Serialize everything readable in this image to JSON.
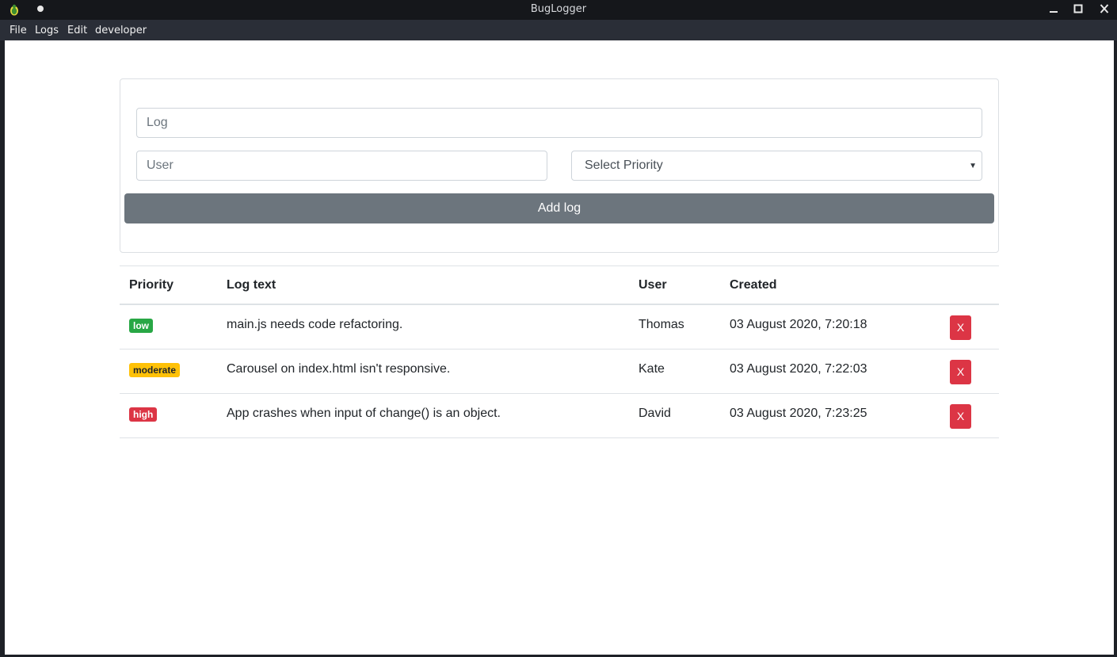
{
  "window": {
    "title": "BugLogger"
  },
  "menu": {
    "file": "File",
    "logs": "Logs",
    "edit": "Edit",
    "developer": "developer"
  },
  "form": {
    "log_placeholder": "Log",
    "user_placeholder": "User",
    "priority_selected": "Select Priority",
    "add_label": "Add log"
  },
  "table": {
    "headers": {
      "priority": "Priority",
      "text": "Log text",
      "user": "User",
      "created": "Created"
    },
    "delete_label": "X",
    "rows": [
      {
        "priority": "low",
        "text": "main.js needs code refactoring.",
        "user": "Thomas",
        "created": "03 August 2020, 7:20:18"
      },
      {
        "priority": "moderate",
        "text": "Carousel on index.html isn't responsive.",
        "user": "Kate",
        "created": "03 August 2020, 7:22:03"
      },
      {
        "priority": "high",
        "text": "App crashes when input of change() is an object.",
        "user": "David",
        "created": "03 August 2020, 7:23:25"
      }
    ]
  },
  "colors": {
    "low": "#28a745",
    "moderate": "#ffc107",
    "high": "#dc3545",
    "delete": "#dc3545",
    "add_button": "#6c757d"
  }
}
